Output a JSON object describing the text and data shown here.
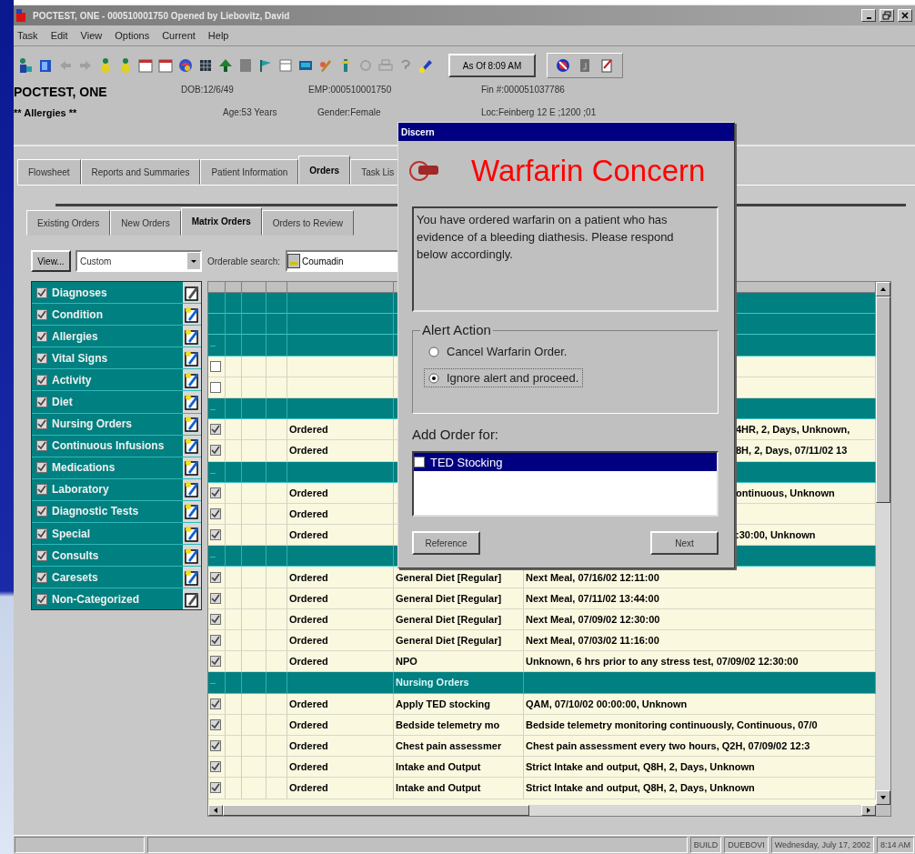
{
  "window": {
    "title": "POCTEST, ONE - 000510001750 Opened by Liebovitz, David"
  },
  "menu": [
    "Task",
    "Edit",
    "View",
    "Options",
    "Current",
    "Help"
  ],
  "toolbar": {
    "as_of": "As Of  8:09 AM"
  },
  "patient": {
    "name": "POCTEST, ONE",
    "allergies": "** Allergies **",
    "dob": "DOB:12/6/49",
    "age": "Age:53 Years",
    "emp": "EMP:000510001750",
    "gender": "Gender:Female",
    "fin": "Fin #:000051037786",
    "loc": "Loc:Feinberg 12 E ;1200 ;01"
  },
  "tabs": [
    {
      "label": "Flowsheet",
      "selected": false
    },
    {
      "label": "Reports and Summaries",
      "selected": false
    },
    {
      "label": "Patient Information",
      "selected": false
    },
    {
      "label": "Orders",
      "selected": true
    },
    {
      "label": "Task Lis",
      "selected": false
    }
  ],
  "subtabs": [
    {
      "label": "Existing Orders",
      "selected": false
    },
    {
      "label": "New Orders",
      "selected": false
    },
    {
      "label": "Matrix Orders",
      "selected": true
    },
    {
      "label": "Orders to Review",
      "selected": false
    }
  ],
  "view_button": "View...",
  "view_select": "Custom",
  "search": {
    "label": "Orderable search:",
    "value": "Coumadin"
  },
  "categories": [
    {
      "label": "Diagnoses",
      "checked": true,
      "flagged": false
    },
    {
      "label": "Condition",
      "checked": true,
      "flagged": true
    },
    {
      "label": "Allergies",
      "checked": true,
      "flagged": true
    },
    {
      "label": "Vital Signs",
      "checked": true,
      "flagged": true
    },
    {
      "label": "Activity",
      "checked": true,
      "flagged": true
    },
    {
      "label": "Diet",
      "checked": true,
      "flagged": true
    },
    {
      "label": "Nursing Orders",
      "checked": true,
      "flagged": true
    },
    {
      "label": "Continuous Infusions",
      "checked": true,
      "flagged": true
    },
    {
      "label": "Medications",
      "checked": true,
      "flagged": true
    },
    {
      "label": "Laboratory",
      "checked": true,
      "flagged": true
    },
    {
      "label": "Diagnostic Tests",
      "checked": true,
      "flagged": true
    },
    {
      "label": "Special",
      "checked": true,
      "flagged": true
    },
    {
      "label": "Consults",
      "checked": true,
      "flagged": true
    },
    {
      "label": "Caresets",
      "checked": true,
      "flagged": true
    },
    {
      "label": "Non-Categorized",
      "checked": true,
      "flagged": false
    }
  ],
  "grid": {
    "rows": [
      {
        "kind": "group"
      },
      {
        "kind": "group"
      },
      {
        "kind": "group",
        "toggle": "–"
      },
      {
        "kind": "partial",
        "checked": false
      },
      {
        "kind": "partial",
        "checked": false
      },
      {
        "kind": "group",
        "toggle": "–"
      },
      {
        "kind": "partial",
        "checked": true,
        "status": "Ordered",
        "details": "4HR, 2, Days, Unknown,"
      },
      {
        "kind": "partial",
        "checked": true,
        "status": "Ordered",
        "details": "8H, 2, Days, 07/11/02 13"
      },
      {
        "kind": "group",
        "toggle": "–"
      },
      {
        "kind": "partial",
        "checked": true,
        "status": "Ordered",
        "details": "ontinuous, Unknown"
      },
      {
        "kind": "partial",
        "checked": true,
        "status": "Ordered"
      },
      {
        "kind": "partial",
        "checked": true,
        "status": "Ordered",
        "details": ":30:00, Unknown"
      },
      {
        "kind": "group",
        "toggle": "–"
      },
      {
        "kind": "order",
        "checked": true,
        "status": "Ordered",
        "name": "General Diet [Regular]",
        "details": "Next Meal, 07/16/02 12:11:00"
      },
      {
        "kind": "order",
        "checked": true,
        "status": "Ordered",
        "name": "General Diet [Regular]",
        "details": "Next Meal, 07/11/02 13:44:00"
      },
      {
        "kind": "order",
        "checked": true,
        "status": "Ordered",
        "name": "General Diet [Regular]",
        "details": "Next Meal, 07/09/02 12:30:00"
      },
      {
        "kind": "order",
        "checked": true,
        "status": "Ordered",
        "name": "General Diet [Regular]",
        "details": "Next Meal, 07/03/02 11:16:00"
      },
      {
        "kind": "order",
        "checked": true,
        "status": "Ordered",
        "name": "NPO",
        "details": "Unknown, 6 hrs prior to any stress test, 07/09/02 12:30:00"
      },
      {
        "kind": "group",
        "toggle": "–",
        "label": "Nursing Orders"
      },
      {
        "kind": "order",
        "checked": true,
        "status": "Ordered",
        "name": "Apply TED stocking",
        "details": "QAM, 07/10/02 00:00:00, Unknown"
      },
      {
        "kind": "order",
        "checked": true,
        "status": "Ordered",
        "name": "Bedside telemetry mo",
        "details": "Bedside telemetry monitoring continuously, Continuous, 07/0"
      },
      {
        "kind": "order",
        "checked": true,
        "status": "Ordered",
        "name": "Chest pain assessmer",
        "details": "Chest pain assessment every two hours, Q2H, 07/09/02 12:3"
      },
      {
        "kind": "order",
        "checked": true,
        "status": "Ordered",
        "name": "Intake and Output",
        "details": "Strict Intake and output, Q8H, 2, Days, Unknown"
      },
      {
        "kind": "order",
        "checked": true,
        "status": "Ordered",
        "name": "Intake and Output",
        "details": "Strict Intake and output, Q8H, 2, Days, Unknown"
      }
    ]
  },
  "dialog": {
    "title": "Discern",
    "heading": "Warfarin Concern",
    "message": "You have ordered warfarin on a patient who has evidence of a bleeding diathesis. Please respond below accordingly.",
    "group_label": "Alert Action",
    "options": [
      {
        "label": "Cancel Warfarin Order.",
        "selected": false
      },
      {
        "label": "Ignore alert and proceed.",
        "selected": true
      }
    ],
    "add_label": "Add Order for:",
    "add_items": [
      {
        "label": "TED Stocking",
        "checked": false,
        "selected": true
      }
    ],
    "buttons": [
      "Reference",
      "Next"
    ]
  },
  "status_bar": [
    "BUILD",
    "DUEBOVI",
    "Wednesday, July 17, 2002",
    "8:14 AM"
  ]
}
